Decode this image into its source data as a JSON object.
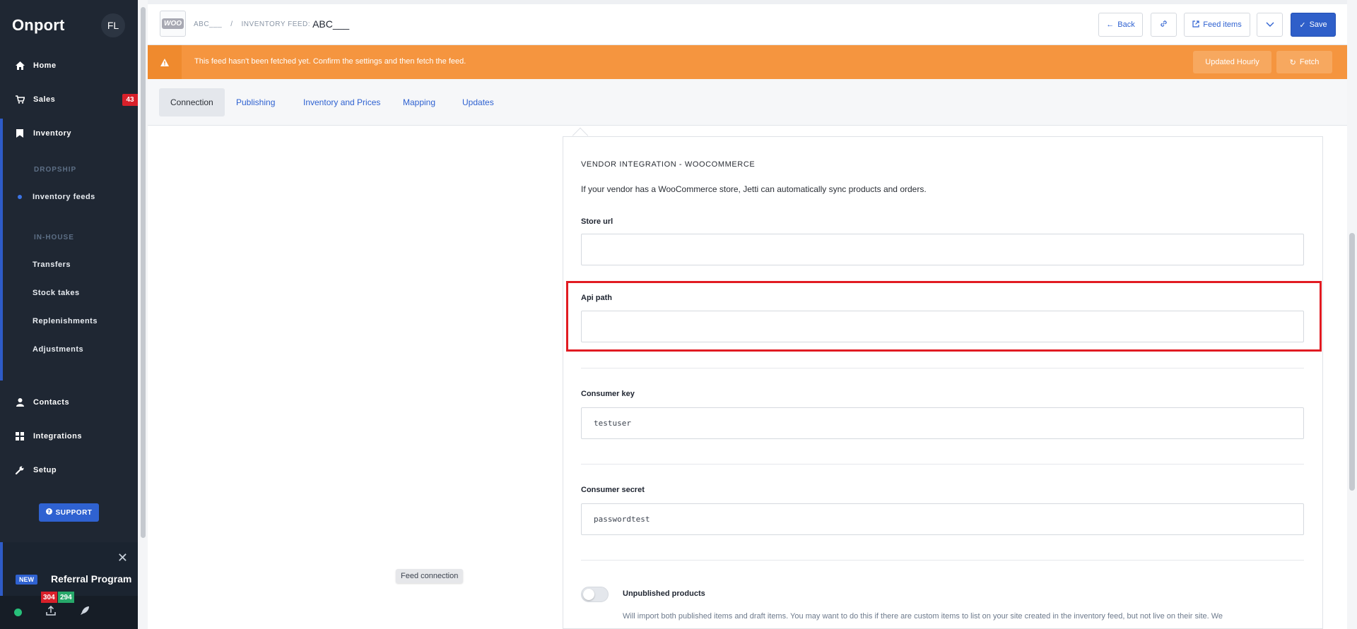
{
  "sidebar": {
    "logo": "Onport",
    "avatar": "FL",
    "nav": {
      "home": "Home",
      "sales": "Sales",
      "sales_badge": "43",
      "inventory": "Inventory",
      "section_dropship": "DROPSHIP",
      "inventory_feeds": "Inventory feeds",
      "section_inhouse": "IN-HOUSE",
      "transfers": "Transfers",
      "stock_takes": "Stock takes",
      "replenishments": "Replenishments",
      "adjustments": "Adjustments",
      "contacts": "Contacts",
      "integrations": "Integrations",
      "setup": "Setup"
    },
    "support": "SUPPORT",
    "referral": {
      "tag": "NEW",
      "title": "Referral Program"
    },
    "badges": {
      "red": "304",
      "green": "294"
    }
  },
  "topbar": {
    "logo_text": "WOO",
    "crumb_first": "ABC___",
    "crumb_sep": "/",
    "crumb_label": "INVENTORY FEED:",
    "crumb_title": "ABC___",
    "back": "Back",
    "feed_items": "Feed items",
    "save": "Save"
  },
  "warning": {
    "text": "This feed hasn't been fetched yet. Confirm the settings and then fetch the feed.",
    "updated": "Updated Hourly",
    "fetch": "Fetch"
  },
  "tabs": [
    "Connection",
    "Publishing",
    "Inventory and Prices",
    "Mapping",
    "Updates"
  ],
  "hint": "Feed connection",
  "panel": {
    "heading": "VENDOR INTEGRATION - WOOCOMMERCE",
    "description": "If your vendor has a WooCommerce store, Jetti can automatically sync products and orders.",
    "fields": {
      "store_url": {
        "label": "Store url",
        "value": ""
      },
      "api_path": {
        "label": "Api path",
        "value": ""
      },
      "consumer_key": {
        "label": "Consumer key",
        "value": "testuser"
      },
      "consumer_secret": {
        "label": "Consumer secret",
        "value": "passwordtest"
      }
    },
    "unpublished": {
      "label": "Unpublished products",
      "description": "Will import both published items and draft items. You may want to do this if there are custom items to list on your site created in the inventory feed, but not live on their site. We"
    }
  },
  "colors": {
    "accent": "#2f62d1",
    "warning": "#f5953f",
    "sidebar": "#1f2733",
    "highlight": "#e11b22"
  }
}
